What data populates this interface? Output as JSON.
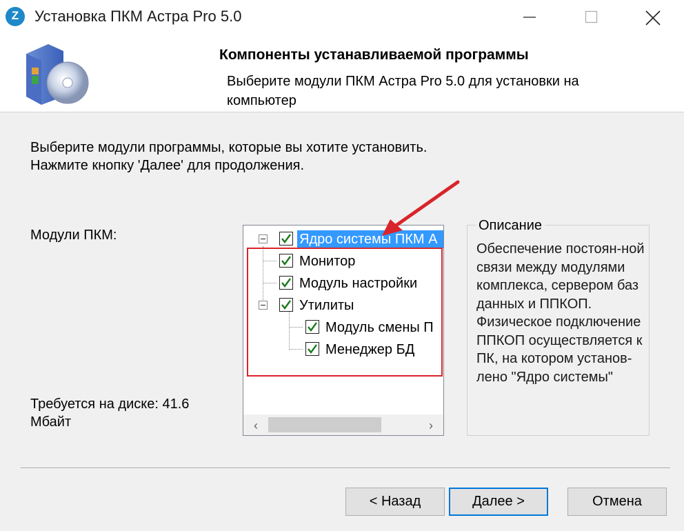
{
  "window": {
    "title": "Установка ПКМ Астра Pro 5.0",
    "app_icon_letter": "Z"
  },
  "header": {
    "title": "Компоненты устанавливаемой программы",
    "subtitle": "Выберите модули ПКМ Астра Pro 5.0 для установки на компьютер"
  },
  "intro": {
    "line1": "Выберите модули программы, которые вы хотите установить.",
    "line2": "Нажмите кнопку 'Далее' для продолжения."
  },
  "modules_label": "Модули ПКМ:",
  "disk": {
    "line1": "Требуется на диске: 41.6",
    "line2": "Мбайт"
  },
  "tree": {
    "root": {
      "label": "Ядро системы ПКМ А",
      "checked": true,
      "selected": true
    },
    "children": [
      {
        "label": "Монитор",
        "checked": true
      },
      {
        "label": "Модуль настройки",
        "checked": true
      },
      {
        "label": "Утилиты",
        "checked": true
      }
    ],
    "utilities_children": [
      {
        "label": "Модуль смены П",
        "checked": true
      },
      {
        "label": "Менеджер БД",
        "checked": true
      }
    ]
  },
  "description": {
    "title": "Описание",
    "text": "Обеспечение постоян-ной связи между модулями комплекса, сервером баз данных и ППКОП. Физическое подключение ППКОП осуществляется к ПК, на котором установ-лено \"Ядро системы\""
  },
  "buttons": {
    "back": "< Назад",
    "next": "Далее >",
    "cancel": "Отмена"
  },
  "colors": {
    "accent": "#0078d7",
    "selection": "#3399ff",
    "annotation_red": "#d9242b",
    "check_green": "#1a7a1a"
  }
}
